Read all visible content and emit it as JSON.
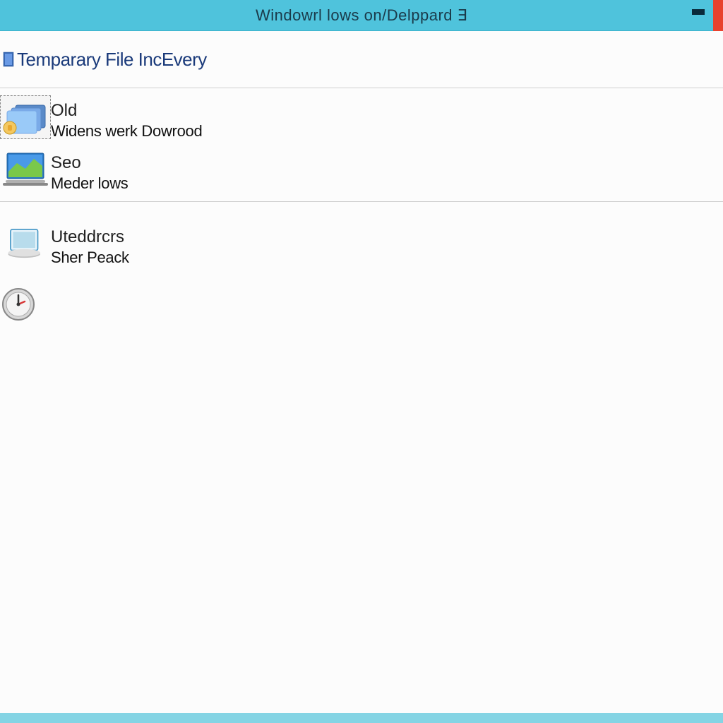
{
  "titlebar": {
    "title": "Windowrl lows on/Delppard ∃"
  },
  "header": {
    "title": "Temparary File IncEvery"
  },
  "section_a": {
    "items": [
      {
        "title": "Old",
        "subtitle": "Widens werk Dowrood"
      },
      {
        "title": "Seo",
        "subtitle": "Meder lows"
      }
    ]
  },
  "section_b": {
    "items": [
      {
        "title": "Uteddrcrs",
        "subtitle": "Sher Peack"
      }
    ]
  }
}
